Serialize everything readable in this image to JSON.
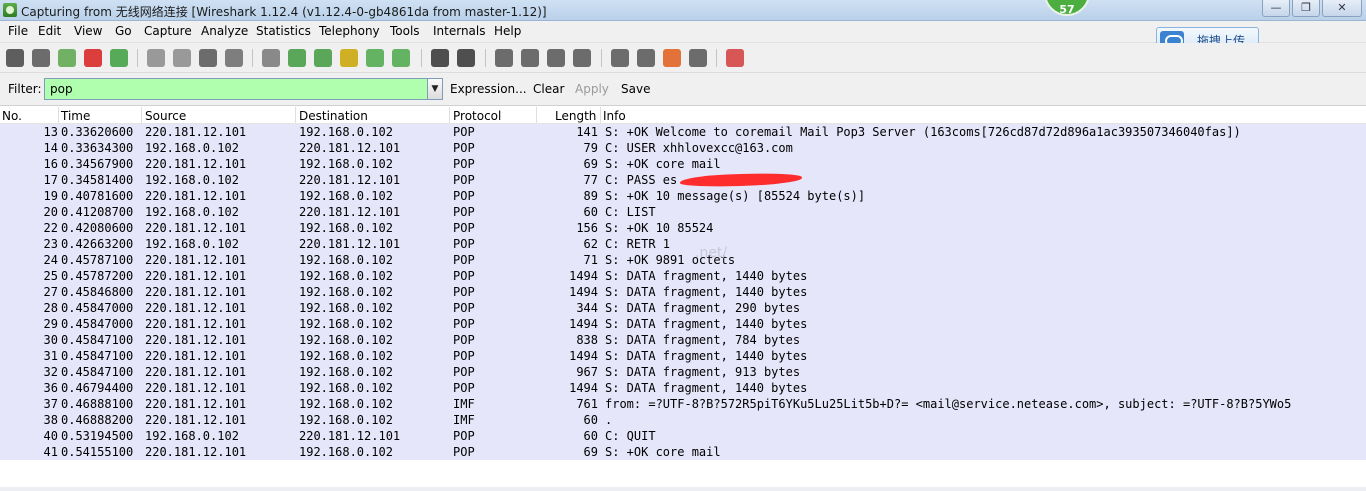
{
  "window": {
    "title": "Capturing from 无线网络连接    [Wireshark 1.12.4  (v1.12.4-0-gb4861da from master-1.12)]",
    "badge": "57",
    "buttons": [
      "—",
      "❐",
      "✕"
    ]
  },
  "menu": [
    "File",
    "Edit",
    "View",
    "Go",
    "Capture",
    "Analyze",
    "Statistics",
    "Telephony",
    "Tools",
    "Internals",
    "Help"
  ],
  "upload_button": {
    "label": "拖拽上传"
  },
  "toolbar": {
    "icons": [
      {
        "name": "interfaces-icon",
        "color": "#444444"
      },
      {
        "name": "options-icon",
        "color": "#555555"
      },
      {
        "name": "start-capture-icon",
        "color": "#5aa64a"
      },
      {
        "name": "stop-capture-icon",
        "color": "#d81f1f"
      },
      {
        "name": "restart-capture-icon",
        "color": "#3c9e3c"
      },
      {
        "name": "open-file-icon",
        "color": "#8a8a8a"
      },
      {
        "name": "save-file-icon",
        "color": "#8a8a8a"
      },
      {
        "name": "close-file-icon",
        "color": "#555555"
      },
      {
        "name": "reload-icon",
        "color": "#6a6a6a"
      },
      {
        "name": "find-packet-icon",
        "color": "#777777"
      },
      {
        "name": "go-back-icon",
        "color": "#3f9a3f"
      },
      {
        "name": "go-forward-icon",
        "color": "#3f9a3f"
      },
      {
        "name": "go-to-packet-icon",
        "color": "#c9a400"
      },
      {
        "name": "first-packet-icon",
        "color": "#4aa84a"
      },
      {
        "name": "last-packet-icon",
        "color": "#4aa84a"
      },
      {
        "name": "colorize-icon",
        "color": "#333333"
      },
      {
        "name": "auto-scroll-icon",
        "color": "#333333"
      },
      {
        "name": "zoom-in-icon",
        "color": "#555555"
      },
      {
        "name": "zoom-out-icon",
        "color": "#555555"
      },
      {
        "name": "normal-size-icon",
        "color": "#555555"
      },
      {
        "name": "resize-columns-icon",
        "color": "#555555"
      },
      {
        "name": "capture-filters-icon",
        "color": "#555555"
      },
      {
        "name": "display-filters-icon",
        "color": "#555555"
      },
      {
        "name": "coloring-rules-icon",
        "color": "#e05a1a"
      },
      {
        "name": "preferences-icon",
        "color": "#555555"
      },
      {
        "name": "help-icon",
        "color": "#d23c3c"
      }
    ]
  },
  "filter": {
    "label": "Filter:",
    "value": "pop",
    "bg_color": "#afffaf",
    "expression": "Expression...",
    "clear": "Clear",
    "apply": "Apply",
    "save": "Save"
  },
  "columns": [
    "No.",
    "Time",
    "Source",
    "Destination",
    "Protocol",
    "Length",
    "Info"
  ],
  "packets": [
    {
      "no": "13",
      "time": "0.33620600",
      "src": "220.181.12.101",
      "dst": "192.168.0.102",
      "proto": "POP",
      "len": "141",
      "info": "S: +OK Welcome to coremail Mail Pop3 Server (163coms[726cd87d72d896a1ac393507346040fas])"
    },
    {
      "no": "14",
      "time": "0.33634300",
      "src": "192.168.0.102",
      "dst": "220.181.12.101",
      "proto": "POP",
      "len": "79",
      "info": "C: USER xhhlovexcc@163.com"
    },
    {
      "no": "16",
      "time": "0.34567900",
      "src": "220.181.12.101",
      "dst": "192.168.0.102",
      "proto": "POP",
      "len": "69",
      "info": "S: +OK core mail"
    },
    {
      "no": "17",
      "time": "0.34581400",
      "src": "192.168.0.102",
      "dst": "220.181.12.101",
      "proto": "POP",
      "len": "77",
      "info": "C: PASS es"
    },
    {
      "no": "19",
      "time": "0.40781600",
      "src": "220.181.12.101",
      "dst": "192.168.0.102",
      "proto": "POP",
      "len": "89",
      "info": "S: +OK 10 message(s) [85524 byte(s)]"
    },
    {
      "no": "20",
      "time": "0.41208700",
      "src": "192.168.0.102",
      "dst": "220.181.12.101",
      "proto": "POP",
      "len": "60",
      "info": "C: LIST"
    },
    {
      "no": "22",
      "time": "0.42080600",
      "src": "220.181.12.101",
      "dst": "192.168.0.102",
      "proto": "POP",
      "len": "156",
      "info": "S: +OK 10 85524"
    },
    {
      "no": "23",
      "time": "0.42663200",
      "src": "192.168.0.102",
      "dst": "220.181.12.101",
      "proto": "POP",
      "len": "62",
      "info": "C: RETR 1"
    },
    {
      "no": "24",
      "time": "0.45787100",
      "src": "220.181.12.101",
      "dst": "192.168.0.102",
      "proto": "POP",
      "len": "71",
      "info": "S: +OK 9891 octets"
    },
    {
      "no": "25",
      "time": "0.45787200",
      "src": "220.181.12.101",
      "dst": "192.168.0.102",
      "proto": "POP",
      "len": "1494",
      "info": "S: DATA fragment, 1440 bytes"
    },
    {
      "no": "27",
      "time": "0.45846800",
      "src": "220.181.12.101",
      "dst": "192.168.0.102",
      "proto": "POP",
      "len": "1494",
      "info": "S: DATA fragment, 1440 bytes"
    },
    {
      "no": "28",
      "time": "0.45847000",
      "src": "220.181.12.101",
      "dst": "192.168.0.102",
      "proto": "POP",
      "len": "344",
      "info": "S: DATA fragment, 290 bytes"
    },
    {
      "no": "29",
      "time": "0.45847000",
      "src": "220.181.12.101",
      "dst": "192.168.0.102",
      "proto": "POP",
      "len": "1494",
      "info": "S: DATA fragment, 1440 bytes"
    },
    {
      "no": "30",
      "time": "0.45847100",
      "src": "220.181.12.101",
      "dst": "192.168.0.102",
      "proto": "POP",
      "len": "838",
      "info": "S: DATA fragment, 784 bytes"
    },
    {
      "no": "31",
      "time": "0.45847100",
      "src": "220.181.12.101",
      "dst": "192.168.0.102",
      "proto": "POP",
      "len": "1494",
      "info": "S: DATA fragment, 1440 bytes"
    },
    {
      "no": "32",
      "time": "0.45847100",
      "src": "220.181.12.101",
      "dst": "192.168.0.102",
      "proto": "POP",
      "len": "967",
      "info": "S: DATA fragment, 913 bytes"
    },
    {
      "no": "36",
      "time": "0.46794400",
      "src": "220.181.12.101",
      "dst": "192.168.0.102",
      "proto": "POP",
      "len": "1494",
      "info": "S: DATA fragment, 1440 bytes"
    },
    {
      "no": "37",
      "time": "0.46888100",
      "src": "220.181.12.101",
      "dst": "192.168.0.102",
      "proto": "IMF",
      "len": "761",
      "info": "from: =?UTF-8?B?572R5piT6YKu5Lu25Lit5b+D?= <mail@service.netease.com>, subject: =?UTF-8?B?5YWo5"
    },
    {
      "no": "38",
      "time": "0.46888200",
      "src": "220.181.12.101",
      "dst": "192.168.0.102",
      "proto": "IMF",
      "len": "60",
      "info": "."
    },
    {
      "no": "40",
      "time": "0.53194500",
      "src": "192.168.0.102",
      "dst": "220.181.12.101",
      "proto": "POP",
      "len": "60",
      "info": "C: QUIT"
    },
    {
      "no": "41",
      "time": "0.54155100",
      "src": "220.181.12.101",
      "dst": "192.168.0.102",
      "proto": "POP",
      "len": "69",
      "info": "S: +OK core mail"
    }
  ],
  "row_color": "#e6e6fa",
  "watermark": "       .net/"
}
